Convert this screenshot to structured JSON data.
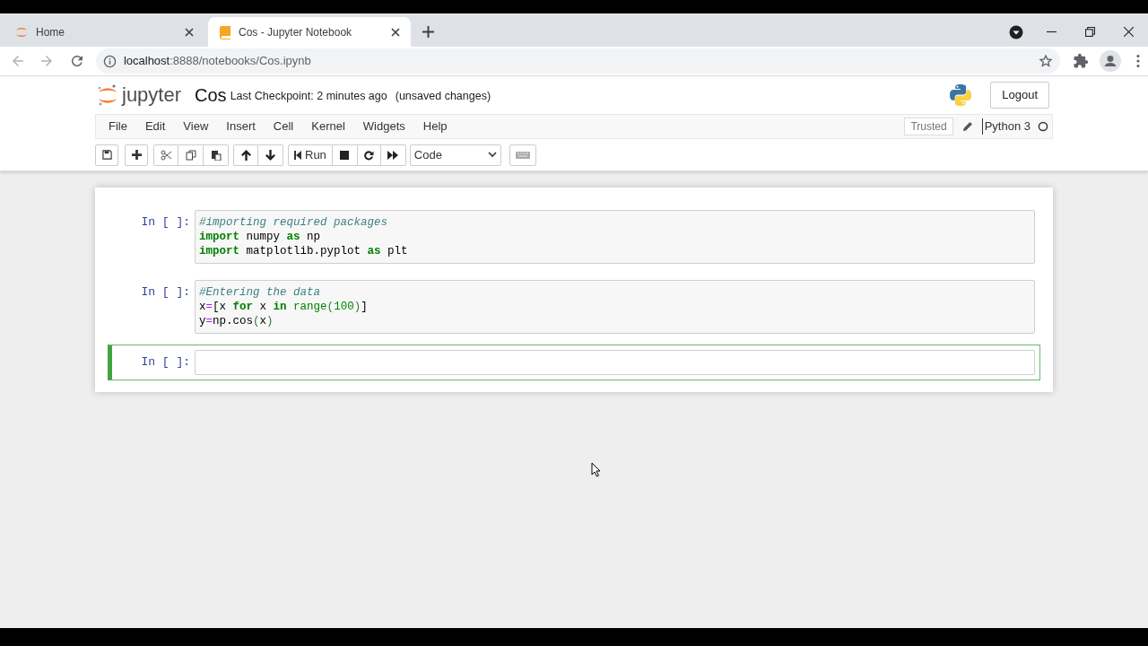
{
  "browser": {
    "tabs": [
      {
        "title": "Home",
        "kind": "jupyter",
        "selected": false
      },
      {
        "title": "Cos - Jupyter Notebook",
        "kind": "book",
        "selected": true
      }
    ],
    "url_host": "localhost",
    "url_rest": ":8888/notebooks/Cos.ipynb"
  },
  "header": {
    "logo_text": "jupyter",
    "notebook_name": "Cos",
    "checkpoint": "Last Checkpoint: 2 minutes ago",
    "autosave_status": "(unsaved changes)",
    "logout": "Logout"
  },
  "menu": [
    "File",
    "Edit",
    "View",
    "Insert",
    "Cell",
    "Kernel",
    "Widgets",
    "Help"
  ],
  "toolbar": {
    "run_label": "Run",
    "cell_type": "Code"
  },
  "status": {
    "trusted": "Trusted",
    "kernel": "Python 3",
    "kernel_busy": false
  },
  "cells": [
    {
      "prompt": "In [ ]:",
      "selected": false,
      "lines": [
        [
          {
            "t": "#importing required packages",
            "kind": "comment"
          }
        ],
        [
          {
            "t": "import",
            "kind": "keyword"
          },
          {
            "t": " numpy ",
            "kind": "name"
          },
          {
            "t": "as",
            "kind": "keyword"
          },
          {
            "t": " np",
            "kind": "name"
          }
        ],
        [
          {
            "t": "import",
            "kind": "keyword"
          },
          {
            "t": " matplotlib.pyplot ",
            "kind": "name"
          },
          {
            "t": "as",
            "kind": "keyword"
          },
          {
            "t": " plt",
            "kind": "name"
          }
        ]
      ]
    },
    {
      "prompt": "In [ ]:",
      "selected": false,
      "lines": [
        [
          {
            "t": "#Entering the data",
            "kind": "comment"
          }
        ],
        [
          {
            "t": "x",
            "kind": "name"
          },
          {
            "t": "=",
            "kind": "operator"
          },
          {
            "t": "[x ",
            "kind": "name"
          },
          {
            "t": "for",
            "kind": "keyword"
          },
          {
            "t": " x ",
            "kind": "name"
          },
          {
            "t": "in",
            "kind": "keyword"
          },
          {
            "t": " range",
            "kind": "builtin"
          },
          {
            "t": "(",
            "kind": "bracket"
          },
          {
            "t": "100",
            "kind": "number"
          },
          {
            "t": ")",
            "kind": "bracket"
          },
          {
            "t": "]",
            "kind": "name"
          }
        ],
        [
          {
            "t": "y",
            "kind": "name"
          },
          {
            "t": "=",
            "kind": "operator"
          },
          {
            "t": "np.cos",
            "kind": "name"
          },
          {
            "t": "(",
            "kind": "bracket"
          },
          {
            "t": "x",
            "kind": "name"
          },
          {
            "t": ")",
            "kind": "bracket"
          }
        ]
      ]
    },
    {
      "prompt": "In [ ]:",
      "selected": true
    }
  ]
}
